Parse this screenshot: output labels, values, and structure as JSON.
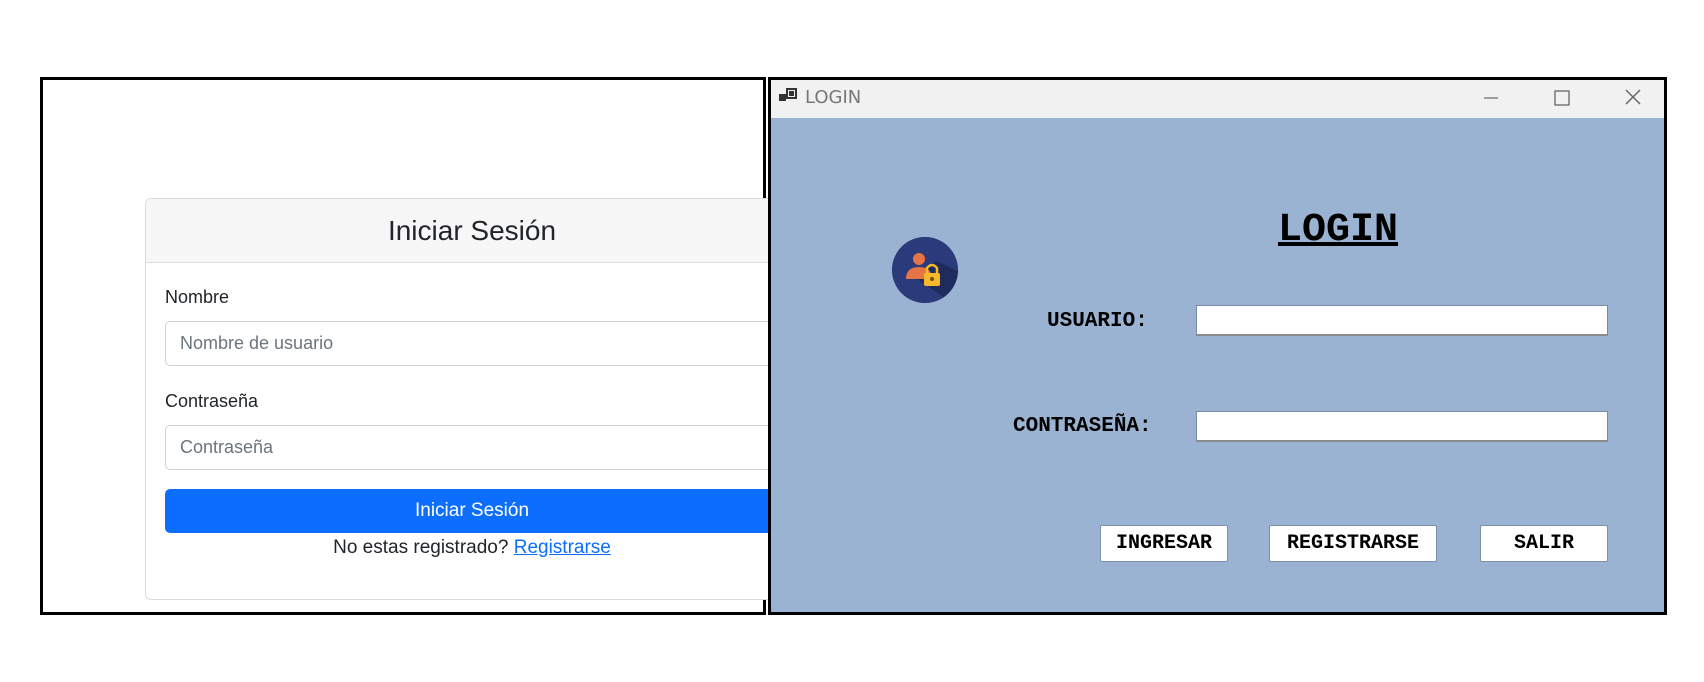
{
  "web_form": {
    "header_title": "Iniciar Sesión",
    "name_label": "Nombre",
    "name_placeholder": "Nombre de usuario",
    "name_value": "",
    "password_label": "Contraseña",
    "password_placeholder": "Contraseña",
    "password_value": "",
    "submit_label": "Iniciar Sesión",
    "register_prompt": "No estas registrado?",
    "register_link": "Registrarse",
    "accent_color": "#0d6efd"
  },
  "desktop_window": {
    "window_title": "LOGIN",
    "heading": "LOGIN",
    "user_label": "USUARIO:",
    "user_value": "",
    "password_label": "CONTRASEÑA:",
    "password_value": "",
    "buttons": {
      "login": "INGRESAR",
      "register": "REGISTRARSE",
      "exit": "SALIR"
    },
    "icons": [
      "app-window-icon",
      "minimize-icon",
      "maximize-icon",
      "close-icon",
      "user-lock-icon"
    ],
    "background_color": "#9ab3d2"
  }
}
